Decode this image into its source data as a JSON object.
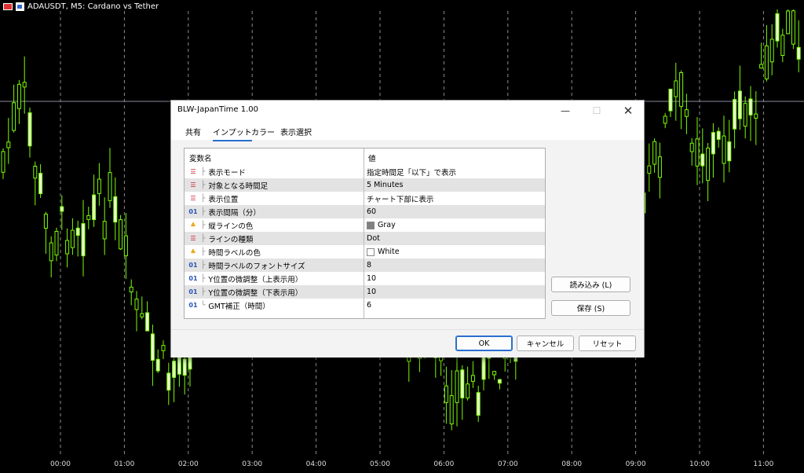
{
  "chart": {
    "symbol_title": "ADAUSDT, M5:  Cardano vs Tether",
    "time_labels": [
      "00:00",
      "01:00",
      "02:00",
      "03:00",
      "04:00",
      "05:00",
      "06:00",
      "07:00",
      "08:00",
      "09:00",
      "10:00",
      "11:00"
    ],
    "colors": {
      "background": "#000000",
      "candle": "#7CFC00",
      "grid": "#ffffff",
      "hline": "#8a8aa0"
    }
  },
  "dialog": {
    "title": "BLW-JapanTime 1.00",
    "tabs": [
      "共有",
      "インプット",
      "カラー",
      "表示選択"
    ],
    "active_tab": "インプット",
    "table": {
      "header_name": "変数名",
      "header_value": "値",
      "rows": [
        {
          "icon": "enum-icon",
          "name": "表示モード",
          "value": "指定時間足「以下」で表示"
        },
        {
          "icon": "enum-icon",
          "name": "対象となる時間足",
          "value": "5 Minutes"
        },
        {
          "icon": "enum-icon",
          "name": "表示位置",
          "value": "チャート下部に表示"
        },
        {
          "icon": "number-icon",
          "name": "表示間隔（分）",
          "value": "60"
        },
        {
          "icon": "color-icon",
          "name": "縦ラインの色",
          "value": "Gray",
          "swatch": "#808080"
        },
        {
          "icon": "enum-icon",
          "name": "ラインの種類",
          "value": "Dot"
        },
        {
          "icon": "color-icon",
          "name": "時間ラベルの色",
          "value": "White",
          "swatch": "#ffffff"
        },
        {
          "icon": "number-icon",
          "name": "時間ラベルのフォントサイズ",
          "value": "8"
        },
        {
          "icon": "number-icon",
          "name": "Y位置の微調整（上表示用）",
          "value": "10"
        },
        {
          "icon": "number-icon",
          "name": "Y位置の微調整（下表示用）",
          "value": "10"
        },
        {
          "icon": "number-icon",
          "name": "GMT補正（時間）",
          "value": "6"
        }
      ]
    },
    "load_button": "読み込み (L)",
    "save_button": "保存 (S)",
    "ok_button": "OK",
    "cancel_button": "キャンセル",
    "reset_button": "リセット",
    "icon_glyphs": {
      "number-icon": "01",
      "enum-icon": "☰",
      "color-icon": "♣"
    }
  }
}
